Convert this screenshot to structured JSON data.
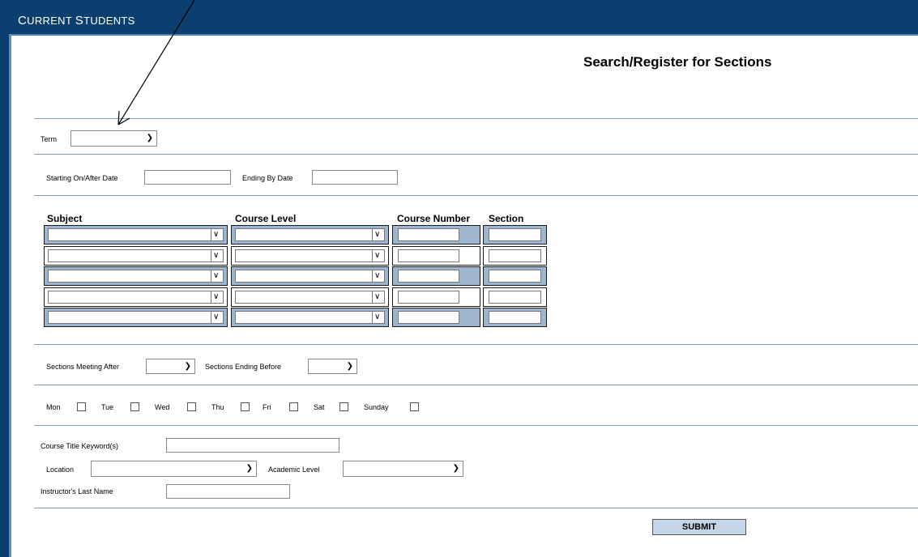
{
  "header": {
    "title_cap1": "C",
    "title_rest1": "URRENT ",
    "title_cap2": "S",
    "title_rest2": "TUDENTS"
  },
  "page_title": "Search/Register for Sections",
  "term": {
    "label": "Term",
    "value": ""
  },
  "dates": {
    "start_label": "Starting On/After Date",
    "start_value": "",
    "end_label": "Ending By Date",
    "end_value": ""
  },
  "course_table": {
    "headers": {
      "subject": "Subject",
      "course_level": "Course Level",
      "course_number": "Course Number",
      "section": "Section"
    },
    "rows": [
      {
        "subject": "",
        "course_level": "",
        "course_number": "",
        "section": ""
      },
      {
        "subject": "",
        "course_level": "",
        "course_number": "",
        "section": ""
      },
      {
        "subject": "",
        "course_level": "",
        "course_number": "",
        "section": ""
      },
      {
        "subject": "",
        "course_level": "",
        "course_number": "",
        "section": ""
      },
      {
        "subject": "",
        "course_level": "",
        "course_number": "",
        "section": ""
      }
    ]
  },
  "times": {
    "after_label": "Sections Meeting After",
    "after_value": "",
    "before_label": "Sections Ending Before",
    "before_value": ""
  },
  "days": [
    {
      "label": "Mon",
      "checked": false
    },
    {
      "label": "Tue",
      "checked": false
    },
    {
      "label": "Wed",
      "checked": false
    },
    {
      "label": "Thu",
      "checked": false
    },
    {
      "label": "Fri",
      "checked": false
    },
    {
      "label": "Sat",
      "checked": false
    },
    {
      "label": "Sunday",
      "checked": false
    }
  ],
  "keyword": {
    "label": "Course Title Keyword(s)",
    "value": ""
  },
  "location": {
    "label": "Location",
    "value": ""
  },
  "academic_level": {
    "label": "Academic Level",
    "value": ""
  },
  "instructor": {
    "label": "Instructor's Last Name",
    "value": ""
  },
  "submit_label": "SUBMIT",
  "colors": {
    "header_bg": "#0b3f6f",
    "row_shade": "#9eb5cf",
    "submit_bg": "#c5d6ea"
  }
}
